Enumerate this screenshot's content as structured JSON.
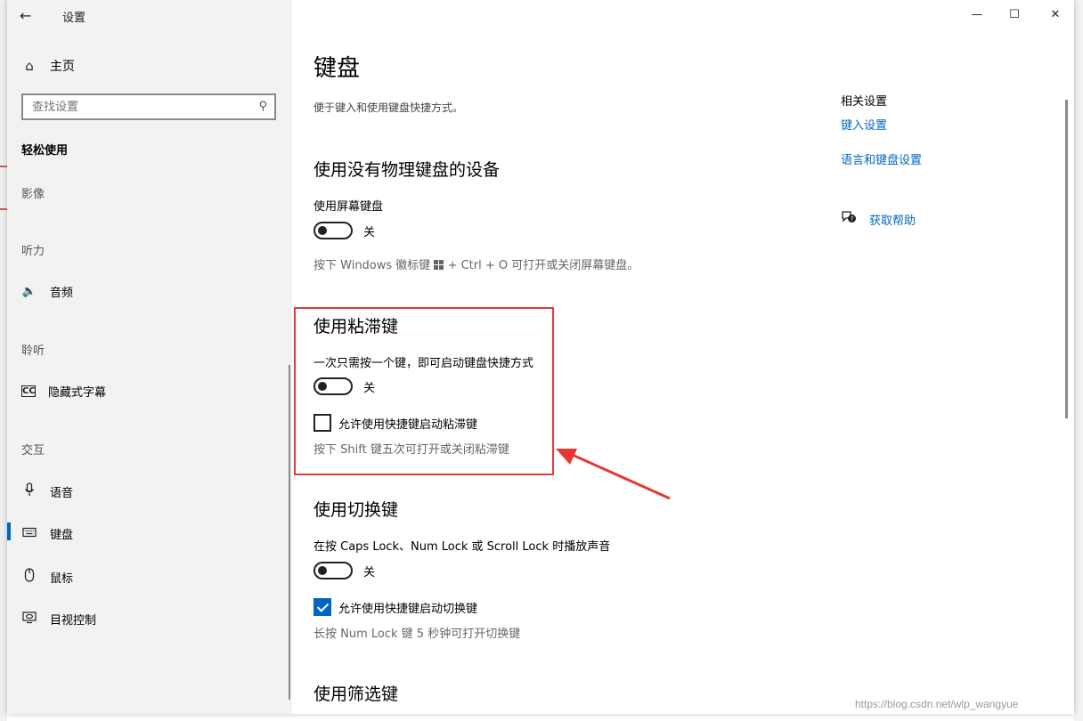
{
  "window": {
    "title": "设置",
    "controls": {
      "minimize": "—",
      "maximize": "☐",
      "close": "✕"
    }
  },
  "sidebar": {
    "home_label": "主页",
    "search_placeholder": "查找设置",
    "section_title": "轻松使用",
    "groups": {
      "vision": "影像",
      "hearing": "听力",
      "listen": "聆听",
      "interaction": "交互"
    },
    "items": {
      "audio": "音频",
      "captions": "隐藏式字幕",
      "speech": "语音",
      "keyboard": "键盘",
      "mouse": "鼠标",
      "eye_control": "目视控制"
    },
    "selected_item": "键盘",
    "accent_color": "#0067c0"
  },
  "main": {
    "title": "键盘",
    "description": "便于键入和使用键盘快捷方式。",
    "osk": {
      "heading": "使用没有物理键盘的设备",
      "label": "使用屏幕键盘",
      "state": "关",
      "hint_prefix": "按下 Windows 徽标键",
      "hint_suffix": "+ Ctrl + O 可打开或关闭屏幕键盘。"
    },
    "sticky": {
      "heading": "使用粘滞键",
      "label": "一次只需按一个键，即可启动键盘快捷方式",
      "state": "关",
      "checkbox_label": "允许使用快捷键启动粘滞键",
      "checkbox_checked": false,
      "hint": "按下 Shift 键五次可打开或关闭粘滞键"
    },
    "toggle_keys": {
      "heading": "使用切换键",
      "label": "在按 Caps Lock、Num Lock 或 Scroll Lock 时播放声音",
      "state": "关",
      "checkbox_label": "允许使用快捷键启动切换键",
      "checkbox_checked": true,
      "hint": "长按 Num Lock 键 5 秒钟可打开切换键"
    },
    "filter_keys": {
      "heading": "使用筛选键"
    }
  },
  "related": {
    "title": "相关设置",
    "links": [
      "键入设置",
      "语言和键盘设置"
    ],
    "help": "获取帮助"
  },
  "annotation": {
    "color": "#e53935"
  },
  "watermark": "https://blog.csdn.net/wlp_wangyue"
}
